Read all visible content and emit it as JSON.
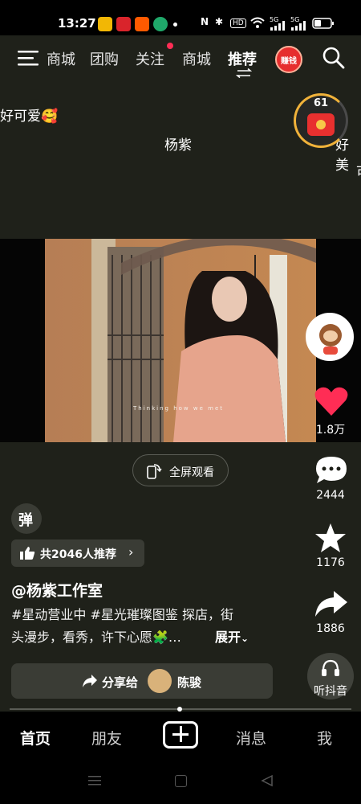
{
  "status": {
    "time": "13:27",
    "hd_badge": "HD",
    "sig1": "5G",
    "sig2": "5G",
    "app_icons": [
      "weibo-icon",
      "news-icon",
      "taobao-icon",
      "maps-icon"
    ]
  },
  "nav": {
    "tabs": [
      "商城",
      "团购",
      "关注",
      "商城",
      "推荐"
    ],
    "coin_label": "赚钱"
  },
  "overlay": {
    "danmaku": [
      "好可爱🥰",
      "杨紫",
      "好美",
      "可"
    ],
    "badge_count": "61",
    "badge_text": "好美"
  },
  "video": {
    "caption_text": "Thinking how we met"
  },
  "fullscreen_label": "全屏观看",
  "danmu_toggle": "弹",
  "recommend": "共2046人推荐",
  "author": "@杨紫工作室",
  "description": {
    "line1": "#星动营业中 #星光璀璨图鉴 探店，街",
    "line2": "头漫步，看秀，许下心愿🧩…",
    "expand": "展开"
  },
  "share": {
    "label": "分享给",
    "friend": "陈骏"
  },
  "rail": {
    "likes": "1.8万",
    "comments": "2444",
    "favorites": "1176",
    "shares": "1886",
    "listen": "听抖音"
  },
  "bottom_nav": {
    "home": "首页",
    "friends": "朋友",
    "messages": "消息",
    "me": "我"
  },
  "colors": {
    "like": "#ff2d55",
    "notify": "#ff2d55",
    "coin": "#e62e2e"
  }
}
